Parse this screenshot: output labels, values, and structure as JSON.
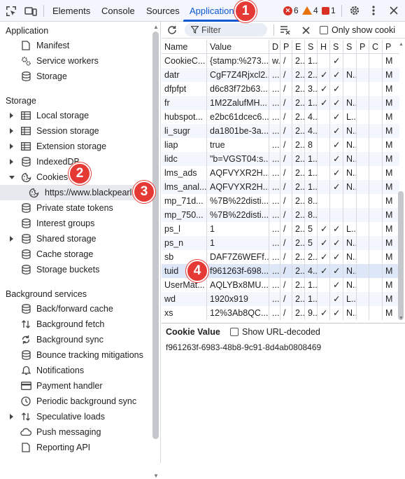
{
  "tabs": [
    {
      "label": "Elements"
    },
    {
      "label": "Console"
    },
    {
      "label": "Sources"
    },
    {
      "label": "Application"
    }
  ],
  "badges": {
    "errors": "6",
    "warnings": "4",
    "issues": "1"
  },
  "annotations": [
    "1",
    "2",
    "3",
    "4"
  ],
  "sidebar": {
    "application_header": "Application",
    "application_items": [
      {
        "label": "Manifest",
        "icon": "file-icon"
      },
      {
        "label": "Service workers",
        "icon": "gears-icon"
      },
      {
        "label": "Storage",
        "icon": "database-icon"
      }
    ],
    "storage_header": "Storage",
    "storage_items": [
      {
        "label": "Local storage",
        "icon": "table-icon"
      },
      {
        "label": "Session storage",
        "icon": "table-icon"
      },
      {
        "label": "Extension storage",
        "icon": "table-icon"
      },
      {
        "label": "IndexedDB",
        "icon": "database-icon"
      },
      {
        "label": "Cookies",
        "icon": "cookie-icon"
      },
      {
        "label": "https://www.blackpearl.c",
        "icon": "cookie-icon"
      },
      {
        "label": "Private state tokens",
        "icon": "database-icon"
      },
      {
        "label": "Interest groups",
        "icon": "database-icon"
      },
      {
        "label": "Shared storage",
        "icon": "database-icon"
      },
      {
        "label": "Cache storage",
        "icon": "database-icon"
      },
      {
        "label": "Storage buckets",
        "icon": "database-icon"
      }
    ],
    "background_header": "Background services",
    "background_items": [
      {
        "label": "Back/forward cache",
        "icon": "database-icon"
      },
      {
        "label": "Background fetch",
        "icon": "arrows-updown-icon"
      },
      {
        "label": "Background sync",
        "icon": "sync-icon"
      },
      {
        "label": "Bounce tracking mitigations",
        "icon": "database-icon"
      },
      {
        "label": "Notifications",
        "icon": "bell-icon"
      },
      {
        "label": "Payment handler",
        "icon": "card-icon"
      },
      {
        "label": "Periodic background sync",
        "icon": "clock-icon"
      },
      {
        "label": "Speculative loads",
        "icon": "arrows-updown-icon"
      },
      {
        "label": "Push messaging",
        "icon": "cloud-icon"
      },
      {
        "label": "Reporting API",
        "icon": "file-icon"
      }
    ]
  },
  "toolbar": {
    "filter_placeholder": "Filter",
    "only_show_label": "Only show cooki"
  },
  "table": {
    "columns": [
      "Name",
      "Value",
      "D",
      "P",
      "E",
      "S",
      "H",
      "S",
      "S",
      "P",
      "C",
      "P"
    ],
    "rows": [
      [
        "CookieC...",
        "{stamp:%273...",
        "w...",
        "/",
        "2...",
        "1...",
        "",
        "✓",
        "",
        "",
        "",
        "M"
      ],
      [
        "datr",
        "CgF7Z4Rjxcl2...",
        "....",
        "/",
        "2...",
        "2...",
        "✓",
        "✓",
        "N...",
        "",
        "",
        "M"
      ],
      [
        "dfpfpt",
        "d6c83f72b63...",
        "....",
        "/",
        "2...",
        "3...",
        "✓",
        "✓",
        "",
        "",
        "",
        "M"
      ],
      [
        "fr",
        "1M2ZalufMH...",
        "....",
        "/",
        "2...",
        "1...",
        "✓",
        "✓",
        "N...",
        "",
        "",
        "M"
      ],
      [
        "hubspot...",
        "e2bc61dcec6...",
        "....",
        "/",
        "2...",
        "4...",
        "",
        "✓",
        "L...",
        "",
        "",
        "M"
      ],
      [
        "li_sugr",
        "da1801be-3a...",
        "....",
        "/",
        "2...",
        "4...",
        "",
        "✓",
        "N...",
        "",
        "",
        "M"
      ],
      [
        "liap",
        "true",
        "....",
        "/",
        "2...",
        "8",
        "",
        "✓",
        "N...",
        "",
        "",
        "M"
      ],
      [
        "lidc",
        "\"b=VGST04:s...",
        "....",
        "/",
        "2...",
        "1...",
        "",
        "✓",
        "N...",
        "",
        "",
        "M"
      ],
      [
        "lms_ads",
        "AQFVYXR2H...",
        "....",
        "/",
        "2...",
        "1...",
        "",
        "✓",
        "N...",
        "",
        "",
        "M"
      ],
      [
        "lms_anal...",
        "AQFVYXR2H...",
        "....",
        "/",
        "2...",
        "1...",
        "",
        "✓",
        "N...",
        "",
        "",
        "M"
      ],
      [
        "mp_71d...",
        "%7B%22disti...",
        "....",
        "/",
        "2...",
        "8...",
        "",
        "",
        "",
        "",
        "",
        "M"
      ],
      [
        "mp_750...",
        "%7B%22disti...",
        "....",
        "/",
        "2...",
        "8...",
        "",
        "",
        "",
        "",
        "",
        "M"
      ],
      [
        "ps_l",
        "1",
        "....",
        "/",
        "2...",
        "5",
        "✓",
        "✓",
        "L...",
        "",
        "",
        "M"
      ],
      [
        "ps_n",
        "1",
        "....",
        "/",
        "2...",
        "5",
        "✓",
        "✓",
        "N...",
        "",
        "",
        "M"
      ],
      [
        "sb",
        "DAF7Z6WEFf...",
        "....",
        "/",
        "2...",
        "2...",
        "✓",
        "✓",
        "N...",
        "",
        "",
        "M"
      ],
      [
        "tuid",
        "f961263f-698...",
        "....",
        "/",
        "2...",
        "4...",
        "✓",
        "✓",
        "N...",
        "",
        "",
        "M"
      ],
      [
        "UserMat...",
        "AQLYBx8MU...",
        "....",
        "/",
        "2...",
        "1...",
        "",
        "✓",
        "N...",
        "",
        "",
        "M"
      ],
      [
        "wd",
        "1920x919",
        "....",
        "/",
        "2...",
        "1...",
        "",
        "✓",
        "L...",
        "",
        "",
        "M"
      ],
      [
        "xs",
        "12%3Ab8QC...",
        "....",
        "/",
        "2...",
        "9...",
        "✓",
        "✓",
        "N...",
        "",
        "",
        "M"
      ]
    ],
    "selected_row": 15
  },
  "cookie_value": {
    "title": "Cookie Value",
    "decode_label": "Show URL-decoded",
    "value": "f961263f-6983-48b8-9c91-8d4ab0808469"
  }
}
